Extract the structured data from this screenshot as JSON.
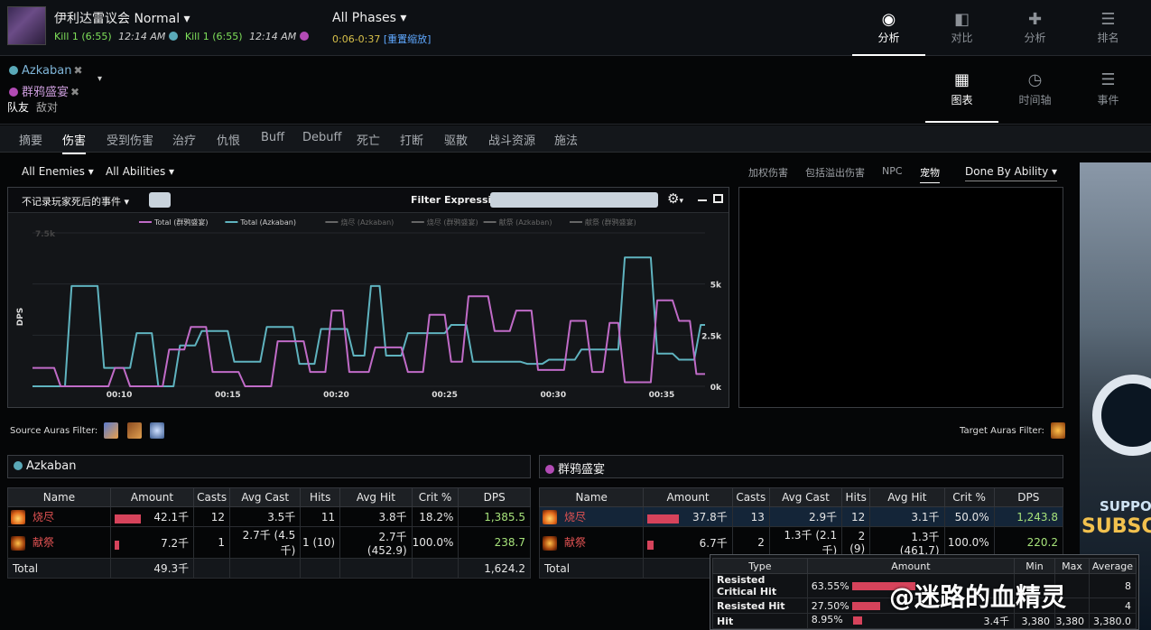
{
  "header": {
    "raid": "伊利达雷议会 Normal",
    "kills": [
      {
        "label": "Kill 1 (6:55)",
        "time": "12:14 AM",
        "color": "#5aa9b8"
      },
      {
        "label": "Kill 1 (6:55)",
        "time": "12:14 AM",
        "color": "#b24bb5"
      }
    ],
    "phase": "All Phases",
    "range": "0:06-0:37",
    "reset": "[重置缩放]",
    "nav": [
      {
        "label": "分析",
        "icon": "eye-icon",
        "glyph": "◉"
      },
      {
        "label": "对比",
        "icon": "compare-icon",
        "glyph": "▐▌"
      },
      {
        "label": "分析",
        "icon": "puzzle-icon",
        "glyph": "✚"
      },
      {
        "label": "排名",
        "icon": "ranking-icon",
        "glyph": "☰"
      }
    ]
  },
  "players": [
    {
      "name": "Azkaban",
      "color": "#5aa9b8"
    },
    {
      "name": "群鸦盛宴",
      "color": "#b24bb5"
    }
  ],
  "team": {
    "friendly": "队友",
    "enemy": "敌对"
  },
  "views": [
    {
      "label": "图表",
      "icon": "table-icon",
      "glyph": "▦"
    },
    {
      "label": "时间轴",
      "icon": "clock-icon",
      "glyph": "◷"
    },
    {
      "label": "事件",
      "icon": "list-icon",
      "glyph": "☰"
    }
  ],
  "tabs": [
    "摘要",
    "伤害",
    "受到伤害",
    "治疗",
    "仇恨",
    "Buff",
    "Debuff",
    "死亡",
    "打断",
    "驱散",
    "战斗资源",
    "施法"
  ],
  "filters": {
    "enemies": "All Enemies",
    "abilities": "All Abilities",
    "options": [
      "加权伤害",
      "包括溢出伤害",
      "NPC",
      "宠物"
    ],
    "done_by": "Done By Ability"
  },
  "graph": {
    "event_filter": "不记录玩家死后的事件",
    "filter_label": "Filter Expression:",
    "ylabel": "DPS",
    "legend": [
      {
        "name": "Total (群鸦盛宴)",
        "color": "#c06bc7"
      },
      {
        "name": "Total (Azkaban)",
        "color": "#5fb3bf"
      },
      {
        "name": "烧尽 (Azkaban)",
        "color": "#666"
      },
      {
        "name": "烧尽 (群鸦盛宴)",
        "color": "#666"
      },
      {
        "name": "献祭 (Azkaban)",
        "color": "#666"
      },
      {
        "name": "献祭 (群鸦盛宴)",
        "color": "#666"
      }
    ],
    "yticks": [
      "7.5k",
      "5k",
      "2.5k",
      "0k"
    ],
    "xticks": [
      "00:10",
      "00:15",
      "00:20",
      "00:25",
      "00:30",
      "00:35"
    ]
  },
  "chart_data": {
    "type": "line",
    "ylabel": "DPS",
    "ylim": [
      0,
      7500
    ],
    "xlim": [
      6,
      37
    ],
    "series": [
      {
        "name": "Total (Azkaban)",
        "color": "#5fb3bf",
        "points": [
          [
            6,
            0
          ],
          [
            7.5,
            0
          ],
          [
            7.8,
            4900
          ],
          [
            9,
            4900
          ],
          [
            9.3,
            900
          ],
          [
            10.5,
            900
          ],
          [
            10.8,
            2600
          ],
          [
            11.5,
            2600
          ],
          [
            11.8,
            0
          ],
          [
            12.5,
            0
          ],
          [
            12.8,
            2000
          ],
          [
            13.5,
            2000
          ],
          [
            13.8,
            2700
          ],
          [
            15,
            2700
          ],
          [
            15.3,
            1200
          ],
          [
            16.5,
            1200
          ],
          [
            16.8,
            2900
          ],
          [
            18,
            2900
          ],
          [
            18.3,
            1100
          ],
          [
            19,
            1100
          ],
          [
            19.3,
            2800
          ],
          [
            20.5,
            2800
          ],
          [
            20.8,
            1500
          ],
          [
            21.3,
            1500
          ],
          [
            21.6,
            4900
          ],
          [
            22,
            4900
          ],
          [
            22.3,
            1500
          ],
          [
            23,
            1500
          ],
          [
            23.3,
            2600
          ],
          [
            25,
            2600
          ],
          [
            25.3,
            3000
          ],
          [
            26,
            3000
          ],
          [
            26.3,
            1200
          ],
          [
            28.5,
            1200
          ],
          [
            28.8,
            1100
          ],
          [
            29.5,
            1100
          ],
          [
            29.8,
            1300
          ],
          [
            31,
            1300
          ],
          [
            31.3,
            1800
          ],
          [
            33,
            1800
          ],
          [
            33.3,
            6300
          ],
          [
            34.5,
            6300
          ],
          [
            34.8,
            1600
          ],
          [
            35.5,
            1600
          ],
          [
            35.8,
            1300
          ],
          [
            36.5,
            1300
          ],
          [
            36.8,
            3000
          ],
          [
            37,
            3000
          ]
        ]
      },
      {
        "name": "Total (群鸦盛宴)",
        "color": "#c06bc7",
        "points": [
          [
            6,
            900
          ],
          [
            7,
            900
          ],
          [
            7.3,
            0
          ],
          [
            9.5,
            0
          ],
          [
            9.8,
            900
          ],
          [
            10.2,
            900
          ],
          [
            10.5,
            0
          ],
          [
            12,
            0
          ],
          [
            12.3,
            1800
          ],
          [
            13,
            1800
          ],
          [
            13.3,
            2900
          ],
          [
            14,
            2900
          ],
          [
            14.3,
            700
          ],
          [
            15.5,
            700
          ],
          [
            15.8,
            0
          ],
          [
            17,
            0
          ],
          [
            17.3,
            2200
          ],
          [
            18.5,
            2200
          ],
          [
            18.8,
            700
          ],
          [
            19.5,
            700
          ],
          [
            19.8,
            3700
          ],
          [
            20.3,
            3700
          ],
          [
            20.6,
            700
          ],
          [
            21.5,
            700
          ],
          [
            21.8,
            1900
          ],
          [
            23,
            1900
          ],
          [
            23.3,
            700
          ],
          [
            24,
            700
          ],
          [
            24.3,
            3500
          ],
          [
            25,
            3500
          ],
          [
            25.3,
            1200
          ],
          [
            25.8,
            1200
          ],
          [
            26.1,
            4400
          ],
          [
            27,
            4400
          ],
          [
            27.3,
            2700
          ],
          [
            28,
            2700
          ],
          [
            28.3,
            3700
          ],
          [
            29,
            3700
          ],
          [
            29.3,
            800
          ],
          [
            30.5,
            800
          ],
          [
            30.8,
            3200
          ],
          [
            31.5,
            3200
          ],
          [
            31.8,
            700
          ],
          [
            32.3,
            700
          ],
          [
            32.6,
            3100
          ],
          [
            33,
            3100
          ],
          [
            33.3,
            200
          ],
          [
            34.5,
            200
          ],
          [
            34.8,
            4200
          ],
          [
            35.5,
            4200
          ],
          [
            35.8,
            3200
          ],
          [
            36.3,
            3200
          ],
          [
            36.6,
            600
          ],
          [
            37,
            600
          ]
        ]
      }
    ]
  },
  "auras": {
    "source_label": "Source Auras Filter:",
    "target_label": "Target Auras Filter:"
  },
  "tables": [
    {
      "player": "Azkaban",
      "color": "#5aa9b8",
      "headers": [
        "Name",
        "Amount",
        "Casts",
        "Avg Cast",
        "Hits",
        "Avg Hit",
        "Crit %",
        "DPS"
      ],
      "rows": [
        {
          "name": "烧尽",
          "icon": "fire",
          "bar": 0.85,
          "amount": "42.1千",
          "casts": "12",
          "avg_cast": "3.5千",
          "hits": "11",
          "avg_hit": "3.8千",
          "crit": "18.2%",
          "dps": "1,385.5"
        },
        {
          "name": "献祭",
          "icon": "sac",
          "bar": 0.15,
          "amount": "7.2千",
          "casts": "1",
          "avg_cast": "2.7千 (4.5千)",
          "hits": "1 (10)",
          "avg_hit": "2.7千 (452.9)",
          "crit": "100.0%",
          "dps": "238.7"
        }
      ],
      "total": {
        "label": "Total",
        "amount": "49.3千",
        "dps": "1,624.2"
      }
    },
    {
      "player": "群鸦盛宴",
      "color": "#b24bb5",
      "headers": [
        "Name",
        "Amount",
        "Casts",
        "Avg Cast",
        "Hits",
        "Avg Hit",
        "Crit %",
        "DPS"
      ],
      "rows": [
        {
          "name": "烧尽",
          "icon": "fire",
          "bar": 0.85,
          "amount": "37.8千",
          "casts": "13",
          "avg_cast": "2.9千",
          "hits": "12",
          "avg_hit": "3.1千",
          "crit": "50.0%",
          "dps": "1,243.8"
        },
        {
          "name": "献祭",
          "icon": "sac",
          "bar": 0.15,
          "amount": "6.7千",
          "casts": "2",
          "avg_cast": "1.3千 (2.1千)",
          "hits": "2 (9)",
          "avg_hit": "1.3千 (461.7)",
          "crit": "100.0%",
          "dps": "220.2"
        }
      ],
      "total": {
        "label": "Total",
        "amount": "4",
        "dps": ""
      }
    }
  ],
  "tooltip": {
    "headers": [
      "Type",
      "Amount",
      "Min",
      "Max",
      "Average"
    ],
    "rows": [
      {
        "type": "Resisted Critical Hit",
        "pct": "63.55%",
        "bar": 0.64,
        "amount": "",
        "min": "",
        "max": "",
        "avg": "8"
      },
      {
        "type": "Resisted Hit",
        "pct": "27.50%",
        "bar": 0.28,
        "amount": "",
        "min": "",
        "max": "",
        "avg": "4"
      },
      {
        "type": "Hit",
        "pct": "8.95%",
        "bar": 0.09,
        "amount": "3.4千",
        "min": "3,380",
        "max": "3,380",
        "avg": "3,380.0"
      }
    ]
  },
  "ad": {
    "line1": "SUPPOR",
    "line2": "SUBSC"
  },
  "watermark": "@迷路的血精灵"
}
